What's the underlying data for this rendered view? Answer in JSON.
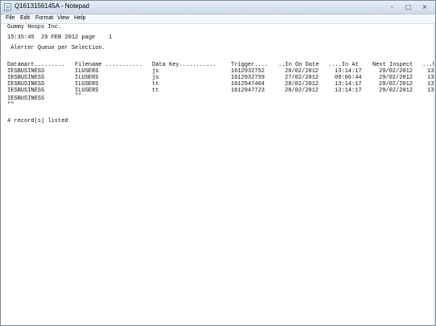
{
  "window": {
    "title": "Q1613156145A - Notepad",
    "buttons": {
      "minimize": "–",
      "maximize": "□",
      "close": "×"
    }
  },
  "menu": [
    "File",
    "Edit",
    "Format",
    "View",
    "Help"
  ],
  "document": {
    "company": "Gummy Hoops Inc.",
    "timestamp_line": "15:35:45  29 FEB 2012 page    1",
    "subtitle": " Alerter Queue per Selection.",
    "headers": [
      "Datamart.........",
      "Filename ...........",
      "Data Key...........",
      "Trigger....",
      "..In On Date",
      "....In At",
      "Next Inspect",
      "...N"
    ],
    "rows": [
      [
        "IESBUSINESS",
        "ILUSERS",
        "js",
        "1612932752",
        "28/02/2012",
        "13:14:17",
        "29/02/2012",
        "13"
      ],
      [
        "IESBUSINESS",
        "ILUSERS",
        "js",
        "1612932759",
        "27/02/2012",
        "09:06:44",
        "29/02/2012",
        "13"
      ],
      [
        "IESBUSINESS",
        "ILUSERS",
        "tt",
        "1612947404",
        "28/02/2012",
        "13:14:17",
        "29/02/2012",
        "13"
      ],
      [
        "IESBUSINESS",
        "ILUSERS",
        "tt",
        "1612947723",
        "28/02/2012",
        "13:14:17",
        "29/02/2012",
        "13"
      ]
    ],
    "row_after_marker": "\"\"",
    "group_line": "IESBUSINESS",
    "group_marker": "\"\"",
    "footer": "4 record(s) listed"
  }
}
